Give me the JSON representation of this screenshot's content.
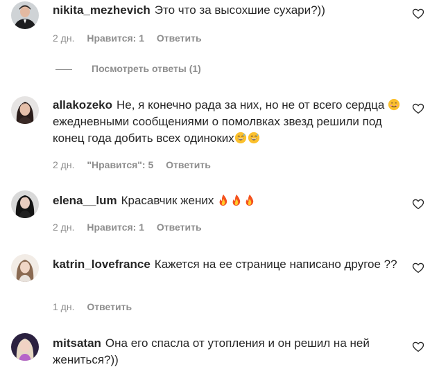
{
  "comments": [
    {
      "username": "nikita_mezhevich",
      "text": "Это что за высохшие сухари?))",
      "time": "2 дн.",
      "likes": "Нравится: 1",
      "reply": "Ответить",
      "view_replies": "Посмотреть ответы (1)"
    },
    {
      "username": "allakozeko",
      "text_part1": "Не, я конечно рада за них, но не от всего сердца",
      "text_part2": "ежедневными сообщениями о помолвках звезд решили под конец года добить всех одиноких",
      "time": "2 дн.",
      "likes": "\"Нравится\": 5",
      "reply": "Ответить"
    },
    {
      "username": "elena__lum",
      "text": "Красавчик жених",
      "time": "2 дн.",
      "likes": "Нравится: 1",
      "reply": "Ответить"
    },
    {
      "username": "katrin_lovefrance",
      "text": "Кажется на ее странице написано другое ??",
      "time": "1 дн.",
      "reply": "Ответить"
    },
    {
      "username": "mitsatan",
      "text": "Она его спасла от утопления и он решил на ней жениться?))"
    }
  ],
  "colors": {
    "text": "#262626",
    "secondary": "#8e8e8e",
    "background": "#ffffff"
  },
  "icons": {
    "like": "heart-outline-icon",
    "smile": "smiling-face-emoji",
    "sweat": "grinning-sweat-emoji",
    "fire": "fire-emoji"
  }
}
